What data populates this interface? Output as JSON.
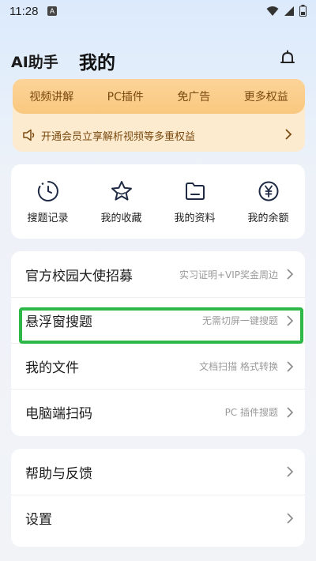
{
  "status": {
    "time": "11:28",
    "indicator": "A"
  },
  "header": {
    "app_name": "AI助手",
    "tab_title": "我的"
  },
  "vip": {
    "benefits": [
      "视频讲解",
      "PC插件",
      "免广告",
      "更多权益"
    ],
    "promo": "开通会员立享解析视频等多重权益"
  },
  "quick": [
    {
      "label": "搜题记录",
      "icon": "history-icon"
    },
    {
      "label": "我的收藏",
      "icon": "star-icon"
    },
    {
      "label": "我的资料",
      "icon": "folder-icon"
    },
    {
      "label": "我的余额",
      "icon": "yen-coin-icon"
    }
  ],
  "list1": [
    {
      "title": "官方校园大使招募",
      "sub": "实习证明+VIP奖金周边"
    },
    {
      "title": "悬浮窗搜题",
      "sub": "无需切屏一键搜题"
    },
    {
      "title": "我的文件",
      "sub": "文档扫描 格式转换"
    },
    {
      "title": "电脑端扫码",
      "sub": "PC 插件搜题"
    }
  ],
  "list2": [
    {
      "title": "帮助与反馈"
    },
    {
      "title": "设置"
    }
  ],
  "colors": {
    "accent_vip": "#f9c87f",
    "highlight": "#2db848",
    "icon": "#1f2a44"
  }
}
